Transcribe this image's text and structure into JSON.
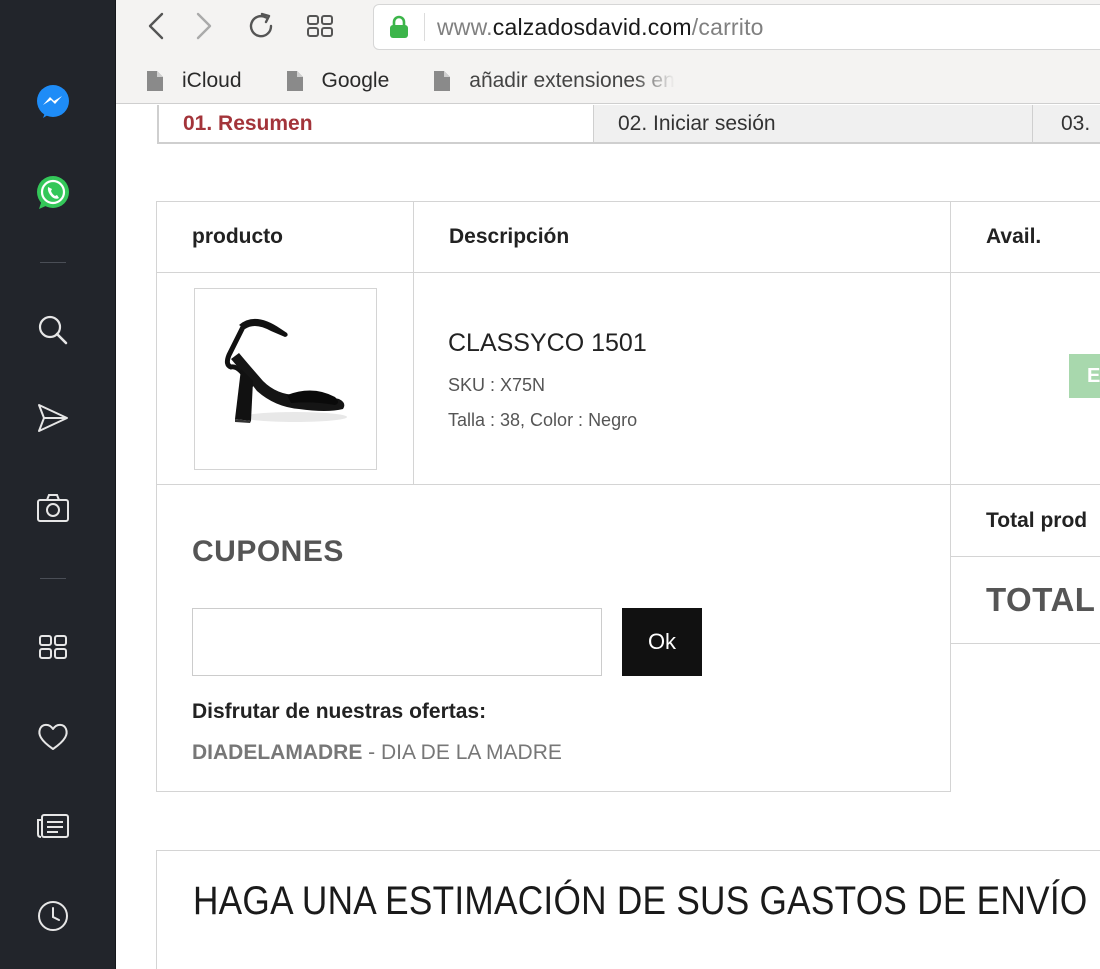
{
  "browser": {
    "url_prefix": "www.",
    "url_domain": "calzadosdavid.com",
    "url_path": "/carrito",
    "bookmarks": [
      {
        "label": "iCloud"
      },
      {
        "label": "Google"
      },
      {
        "label": "añadir extensiones en"
      }
    ]
  },
  "sidebar": {
    "icons": [
      "messenger-icon",
      "whatsapp-icon",
      "search-icon",
      "send-icon",
      "camera-icon",
      "speed-dial-icon",
      "heart-icon",
      "news-icon",
      "history-icon"
    ]
  },
  "checkout_steps": [
    {
      "label": "01. Resumen",
      "active": true
    },
    {
      "label": "02. Iniciar sesión",
      "active": false
    },
    {
      "label": "03.",
      "active": false
    }
  ],
  "cart_table": {
    "headers": {
      "product": "producto",
      "description": "Descripción",
      "avail": "Avail."
    },
    "item": {
      "name": "CLASSYCO 1501",
      "sku": "SKU : X75N",
      "attributes": "Talla : 38, Color : Negro",
      "avail_badge": "E"
    }
  },
  "coupons": {
    "title": "CUPONES",
    "input_value": "",
    "ok_label": "Ok",
    "offers_label": "Disfrutar de nuestras ofertas:",
    "offer_code": "DIADELAMADRE",
    "offer_separator": " - ",
    "offer_name": "DIA DE LA MADRE"
  },
  "totals": {
    "total_products_label": "Total prod",
    "total_label": "TOTAL"
  },
  "shipping": {
    "title": "HAGA UNA ESTIMACIÓN DE SUS GASTOS DE ENVÍO E IM"
  },
  "colors": {
    "sidebar_bg": "#22252b",
    "active_step": "#a3343a",
    "ok_button": "#111111",
    "avail_badge": "#a8d8ad",
    "lock_green": "#3cb54a",
    "messenger_blue": "#1e8cf7",
    "whatsapp_green": "#34c759"
  }
}
